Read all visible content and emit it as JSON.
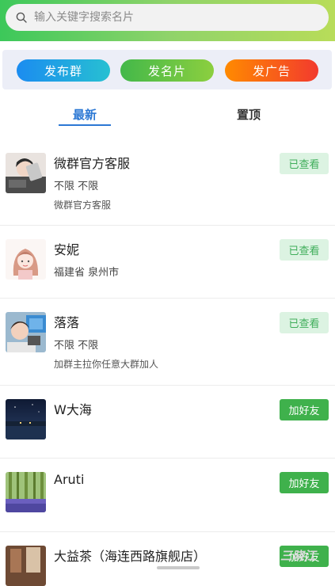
{
  "search": {
    "placeholder": "输入关键字搜索名片"
  },
  "actions": {
    "publish_group": "发布群",
    "publish_card": "发名片",
    "publish_ad": "发广告"
  },
  "tabs": {
    "latest": "最新",
    "pinned": "置顶"
  },
  "list": [
    {
      "name": "微群官方客服",
      "region": "不限 不限",
      "desc": "微群官方客服",
      "button": "已查看"
    },
    {
      "name": "安妮",
      "region": "福建省 泉州市",
      "desc": "",
      "button": "已查看"
    },
    {
      "name": "落落",
      "region": "不限 不限",
      "desc": "加群主拉你任意大群加人",
      "button": "已查看"
    },
    {
      "name": "W大海",
      "region": "",
      "desc": "",
      "button": "加好友"
    },
    {
      "name": "Aruti",
      "region": "",
      "desc": "",
      "button": "加好友"
    },
    {
      "name": "大益茶（海连西路旗舰店）",
      "region": "",
      "desc": "",
      "button": "加好友"
    }
  ],
  "watermark": "三晓江",
  "colors": {
    "accent_blue": "#2c78d4",
    "green": "#3fb14c",
    "viewed_bg": "#dcf3e2"
  }
}
